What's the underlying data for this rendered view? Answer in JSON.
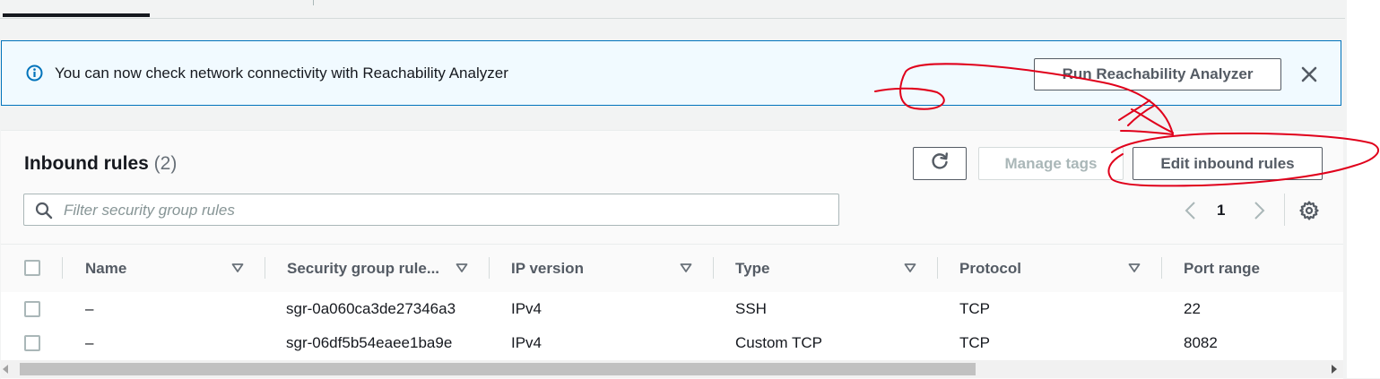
{
  "flash": {
    "message": "You can now check network connectivity with Reachability Analyzer",
    "action_label": "Run Reachability Analyzer",
    "icon": "info-icon",
    "close_icon": "close-icon"
  },
  "panel": {
    "title": "Inbound rules",
    "count": "(2)",
    "refresh_icon": "refresh-icon",
    "manage_tags_label": "Manage tags",
    "edit_label": "Edit inbound rules",
    "filter_placeholder": "Filter security group rules",
    "page_number": "1"
  },
  "table": {
    "columns": [
      "Name",
      "Security group rule...",
      "IP version",
      "Type",
      "Protocol",
      "Port range"
    ],
    "rows": [
      {
        "name": "–",
        "rule_id": "sgr-0a060ca3de27346a3",
        "ip_version": "IPv4",
        "type": "SSH",
        "protocol": "TCP",
        "port_range": "22"
      },
      {
        "name": "–",
        "rule_id": "sgr-06df5b54eaee1ba9e",
        "ip_version": "IPv4",
        "type": "Custom TCP",
        "protocol": "TCP",
        "port_range": "8082"
      }
    ]
  },
  "colors": {
    "info_blue": "#0073bb",
    "flash_bg": "#f1faff",
    "annotation_red": "#e0001b"
  }
}
